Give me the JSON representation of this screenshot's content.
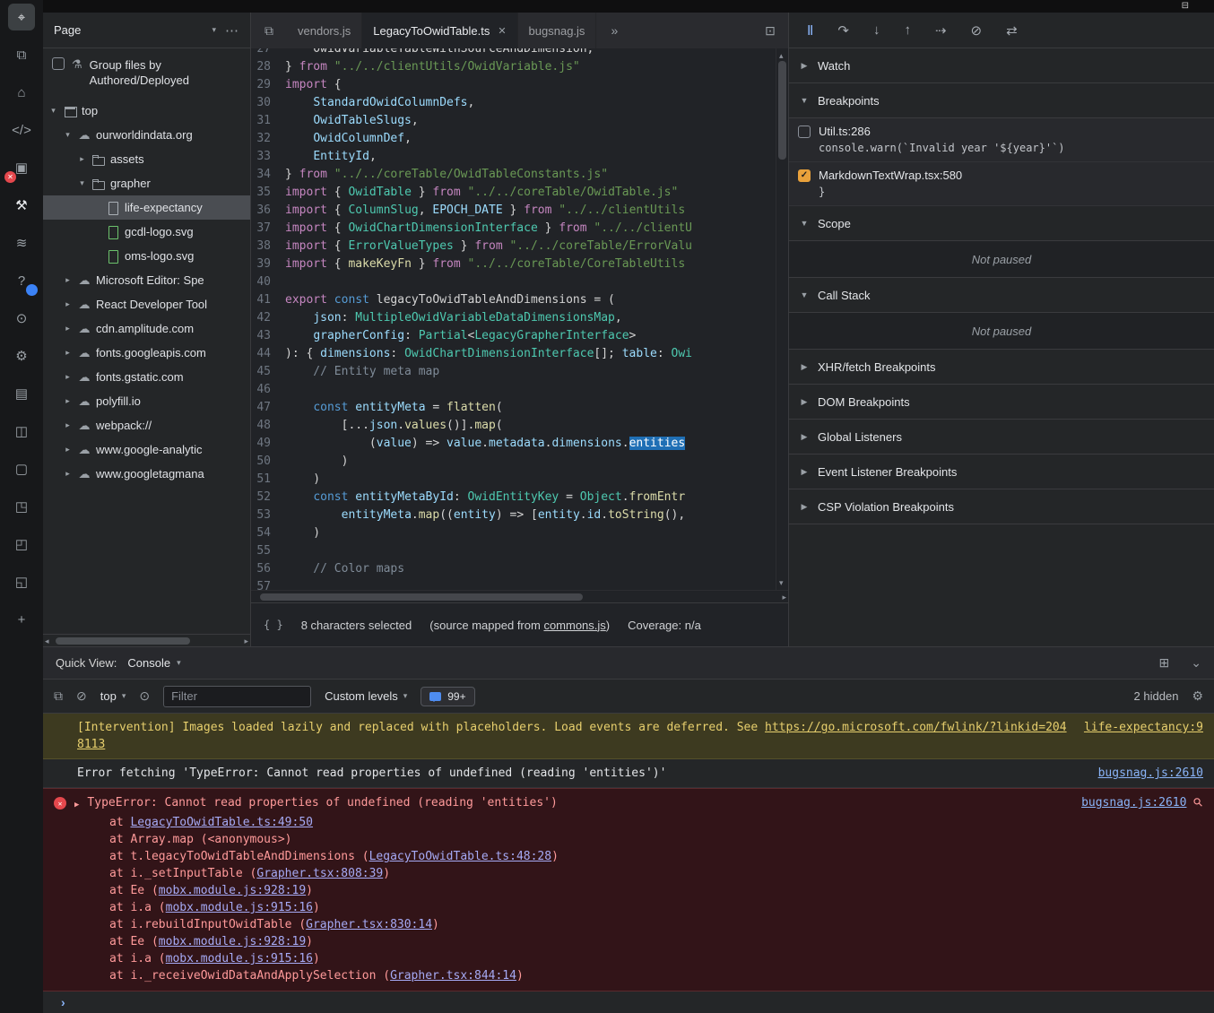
{
  "colors": {
    "breakpoint_checked": "#e9a13b",
    "warning_text": "#e7cf6d",
    "error_text": "#ff9a9a",
    "link_blue": "#8ab4f8",
    "stack_link": "#a6aaf5",
    "selection_highlight": "#1f6fb5",
    "breakpoint_badge_red": "#e5484d",
    "badge_blue": "#3b82f6"
  },
  "titlebar": {
    "dock_icon_glyph": "⊟"
  },
  "activity_bar": {
    "icons": [
      {
        "name": "inspect-element",
        "glyph": "⌖",
        "active": true
      },
      {
        "name": "device-emulation",
        "glyph": "⧉"
      },
      {
        "name": "welcome-home",
        "glyph": "⌂"
      },
      {
        "name": "elements",
        "glyph": "</>"
      },
      {
        "name": "console-errors",
        "glyph": "▣",
        "badge": "red",
        "badge_glyph": "✕"
      },
      {
        "name": "debugger",
        "glyph": "⚒",
        "hl": true
      },
      {
        "name": "network",
        "glyph": "≋"
      },
      {
        "name": "issues-help",
        "glyph": "?",
        "badge": "blue",
        "badge_glyph": ""
      },
      {
        "name": "performance",
        "glyph": "⊙"
      },
      {
        "name": "settings-gear",
        "glyph": "⚙"
      },
      {
        "name": "layers",
        "glyph": "▤"
      },
      {
        "name": "application",
        "glyph": "◫"
      },
      {
        "name": "sources-box",
        "glyph": "▢"
      },
      {
        "name": "package",
        "glyph": "◳"
      },
      {
        "name": "extension-a",
        "glyph": "◰"
      },
      {
        "name": "extension-b",
        "glyph": "◱"
      },
      {
        "name": "more-tools-add",
        "glyph": "+"
      }
    ]
  },
  "navigator": {
    "header": {
      "dropdown_label": "Page",
      "more_glyph": "⋯",
      "chevron": "▾"
    },
    "group_toggle": {
      "label": "Group files by Authored/Deployed",
      "checked": false,
      "flask_glyph": "⚗"
    },
    "tree": [
      {
        "label": "top",
        "type": "frame",
        "depth": 0,
        "chevron": "expanded"
      },
      {
        "label": "ourworldindata.org",
        "type": "domain",
        "depth": 1,
        "chevron": "expanded"
      },
      {
        "label": "assets",
        "type": "folder",
        "depth": 2,
        "chevron": "collapsed"
      },
      {
        "label": "grapher",
        "type": "folder",
        "depth": 2,
        "chevron": "expanded"
      },
      {
        "label": "life-expectancy",
        "type": "file",
        "depth": 3,
        "selected": true
      },
      {
        "label": "gcdl-logo.svg",
        "type": "image-file",
        "depth": 3
      },
      {
        "label": "oms-logo.svg",
        "type": "image-file",
        "depth": 3
      },
      {
        "label": "Microsoft Editor: Spe",
        "type": "domain",
        "depth": 1,
        "chevron": "collapsed"
      },
      {
        "label": "React Developer Tool",
        "type": "domain",
        "depth": 1,
        "chevron": "collapsed"
      },
      {
        "label": "cdn.amplitude.com",
        "type": "domain",
        "depth": 1,
        "chevron": "collapsed"
      },
      {
        "label": "fonts.googleapis.com",
        "type": "domain",
        "depth": 1,
        "chevron": "collapsed"
      },
      {
        "label": "fonts.gstatic.com",
        "type": "domain",
        "depth": 1,
        "chevron": "collapsed"
      },
      {
        "label": "polyfill.io",
        "type": "domain",
        "depth": 1,
        "chevron": "collapsed"
      },
      {
        "label": "webpack://",
        "type": "domain",
        "depth": 1,
        "chevron": "collapsed"
      },
      {
        "label": "www.google-analytic",
        "type": "domain",
        "depth": 1,
        "chevron": "collapsed"
      },
      {
        "label": "www.googletagmana",
        "type": "domain",
        "depth": 1,
        "chevron": "collapsed"
      }
    ]
  },
  "editor": {
    "tabs": {
      "open_icon_glyph": "⧉",
      "overflow_glyph": "»",
      "panel_icon_glyph": "⊡",
      "close_glyph": "✕",
      "items": [
        {
          "label": "vendors.js",
          "active": false
        },
        {
          "label": "LegacyToOwidTable.ts",
          "active": true,
          "closable": true
        },
        {
          "label": "bugsnag.js",
          "active": false
        }
      ]
    },
    "lines": [
      {
        "num": 27,
        "tokens": [
          [
            "d",
            "    OwidVariableTableWithSourceAndDimension,"
          ]
        ]
      },
      {
        "num": 28,
        "tokens": [
          [
            "d",
            "} "
          ],
          [
            "k",
            "from"
          ],
          [
            "d",
            " "
          ],
          [
            "s",
            "\"../../clientUtils/OwidVariable.js\""
          ]
        ]
      },
      {
        "num": 29,
        "tokens": [
          [
            "k",
            "import"
          ],
          [
            "d",
            " {"
          ]
        ]
      },
      {
        "num": 30,
        "tokens": [
          [
            "d",
            "    "
          ],
          [
            "v",
            "StandardOwidColumnDefs"
          ],
          [
            "d",
            ","
          ]
        ]
      },
      {
        "num": 31,
        "tokens": [
          [
            "d",
            "    "
          ],
          [
            "v",
            "OwidTableSlugs"
          ],
          [
            "d",
            ","
          ]
        ]
      },
      {
        "num": 32,
        "tokens": [
          [
            "d",
            "    "
          ],
          [
            "v",
            "OwidColumnDef"
          ],
          [
            "d",
            ","
          ]
        ]
      },
      {
        "num": 33,
        "tokens": [
          [
            "d",
            "    "
          ],
          [
            "v",
            "EntityId"
          ],
          [
            "d",
            ","
          ]
        ]
      },
      {
        "num": 34,
        "tokens": [
          [
            "d",
            "} "
          ],
          [
            "k",
            "from"
          ],
          [
            "d",
            " "
          ],
          [
            "s",
            "\"../../coreTable/OwidTableConstants.js\""
          ]
        ]
      },
      {
        "num": 35,
        "tokens": [
          [
            "k",
            "import"
          ],
          [
            "d",
            " { "
          ],
          [
            "t",
            "OwidTable"
          ],
          [
            "d",
            " } "
          ],
          [
            "k",
            "from"
          ],
          [
            "d",
            " "
          ],
          [
            "s",
            "\"../../coreTable/OwidTable.js\""
          ]
        ]
      },
      {
        "num": 36,
        "tokens": [
          [
            "k",
            "import"
          ],
          [
            "d",
            " { "
          ],
          [
            "t",
            "ColumnSlug"
          ],
          [
            "d",
            ", "
          ],
          [
            "v",
            "EPOCH_DATE"
          ],
          [
            "d",
            " } "
          ],
          [
            "k",
            "from"
          ],
          [
            "d",
            " "
          ],
          [
            "s",
            "\"../../clientUtils"
          ]
        ]
      },
      {
        "num": 37,
        "tokens": [
          [
            "k",
            "import"
          ],
          [
            "d",
            " { "
          ],
          [
            "t",
            "OwidChartDimensionInterface"
          ],
          [
            "d",
            " } "
          ],
          [
            "k",
            "from"
          ],
          [
            "d",
            " "
          ],
          [
            "s",
            "\"../../clientU"
          ]
        ]
      },
      {
        "num": 38,
        "tokens": [
          [
            "k",
            "import"
          ],
          [
            "d",
            " { "
          ],
          [
            "t",
            "ErrorValueTypes"
          ],
          [
            "d",
            " } "
          ],
          [
            "k",
            "from"
          ],
          [
            "d",
            " "
          ],
          [
            "s",
            "\"../../coreTable/ErrorValu"
          ]
        ]
      },
      {
        "num": 39,
        "tokens": [
          [
            "k",
            "import"
          ],
          [
            "d",
            " { "
          ],
          [
            "f",
            "makeKeyFn"
          ],
          [
            "d",
            " } "
          ],
          [
            "k",
            "from"
          ],
          [
            "d",
            " "
          ],
          [
            "s",
            "\"../../coreTable/CoreTableUtils"
          ]
        ]
      },
      {
        "num": 40,
        "tokens": []
      },
      {
        "num": 41,
        "tokens": [
          [
            "k",
            "export"
          ],
          [
            "d",
            " "
          ],
          [
            "kb",
            "const"
          ],
          [
            "d",
            " legacyToOwidTableAndDimensions = ("
          ]
        ]
      },
      {
        "num": 42,
        "tokens": [
          [
            "d",
            "    "
          ],
          [
            "v",
            "json"
          ],
          [
            "d",
            ": "
          ],
          [
            "t",
            "MultipleOwidVariableDataDimensionsMap"
          ],
          [
            "d",
            ","
          ]
        ]
      },
      {
        "num": 43,
        "tokens": [
          [
            "d",
            "    "
          ],
          [
            "v",
            "grapherConfig"
          ],
          [
            "d",
            ": "
          ],
          [
            "t",
            "Partial"
          ],
          [
            "d",
            "<"
          ],
          [
            "t",
            "LegacyGrapherInterface"
          ],
          [
            "d",
            ">"
          ]
        ]
      },
      {
        "num": 44,
        "tokens": [
          [
            "d",
            "): { "
          ],
          [
            "v",
            "dimensions"
          ],
          [
            "d",
            ": "
          ],
          [
            "t",
            "OwidChartDimensionInterface"
          ],
          [
            "d",
            "[]; "
          ],
          [
            "v",
            "table"
          ],
          [
            "d",
            ": "
          ],
          [
            "t",
            "Owi"
          ]
        ]
      },
      {
        "num": 45,
        "tokens": [
          [
            "c",
            "    // Entity meta map"
          ]
        ]
      },
      {
        "num": 46,
        "tokens": []
      },
      {
        "num": 47,
        "tokens": [
          [
            "d",
            "    "
          ],
          [
            "kb",
            "const"
          ],
          [
            "d",
            " "
          ],
          [
            "v",
            "entityMeta"
          ],
          [
            "d",
            " = "
          ],
          [
            "f",
            "flatten"
          ],
          [
            "d",
            "("
          ]
        ]
      },
      {
        "num": 48,
        "tokens": [
          [
            "d",
            "        [..."
          ],
          [
            "v",
            "json"
          ],
          [
            "d",
            "."
          ],
          [
            "f",
            "values"
          ],
          [
            "d",
            "()]."
          ],
          [
            "f",
            "map"
          ],
          [
            "d",
            "("
          ]
        ]
      },
      {
        "num": 49,
        "tokens": [
          [
            "d",
            "            ("
          ],
          [
            "v",
            "value"
          ],
          [
            "d",
            ") => "
          ],
          [
            "v",
            "value"
          ],
          [
            "d",
            "."
          ],
          [
            "v",
            "metadata"
          ],
          [
            "d",
            "."
          ],
          [
            "v",
            "dimensions"
          ],
          [
            "d",
            "."
          ],
          [
            "sel",
            "entities"
          ]
        ]
      },
      {
        "num": 50,
        "tokens": [
          [
            "d",
            "        )"
          ]
        ]
      },
      {
        "num": 51,
        "tokens": [
          [
            "d",
            "    )"
          ]
        ]
      },
      {
        "num": 52,
        "tokens": [
          [
            "d",
            "    "
          ],
          [
            "kb",
            "const"
          ],
          [
            "d",
            " "
          ],
          [
            "v",
            "entityMetaById"
          ],
          [
            "d",
            ": "
          ],
          [
            "t",
            "OwidEntityKey"
          ],
          [
            "d",
            " = "
          ],
          [
            "t",
            "Object"
          ],
          [
            "d",
            "."
          ],
          [
            "f",
            "fromEntr"
          ]
        ]
      },
      {
        "num": 53,
        "tokens": [
          [
            "d",
            "        "
          ],
          [
            "v",
            "entityMeta"
          ],
          [
            "d",
            "."
          ],
          [
            "f",
            "map"
          ],
          [
            "d",
            "(("
          ],
          [
            "v",
            "entity"
          ],
          [
            "d",
            ") => ["
          ],
          [
            "v",
            "entity"
          ],
          [
            "d",
            "."
          ],
          [
            "v",
            "id"
          ],
          [
            "d",
            "."
          ],
          [
            "f",
            "toString"
          ],
          [
            "d",
            "(),"
          ]
        ]
      },
      {
        "num": 54,
        "tokens": [
          [
            "d",
            "    )"
          ]
        ]
      },
      {
        "num": 55,
        "tokens": []
      },
      {
        "num": 56,
        "tokens": [
          [
            "c",
            "    // Color maps"
          ]
        ]
      },
      {
        "num": 57,
        "tokens": []
      }
    ],
    "status": {
      "brace_glyph": "{ }",
      "selection": "8 characters selected",
      "mapped_prefix": "(source mapped from ",
      "mapped_link": "commons.js",
      "mapped_suffix": ")",
      "coverage": "Coverage: n/a"
    }
  },
  "debug_sidebar": {
    "toolbar": [
      {
        "name": "pause",
        "glyph": "Ⅱ",
        "accent": true
      },
      {
        "name": "step-over",
        "glyph": "↷"
      },
      {
        "name": "step-into",
        "glyph": "↓"
      },
      {
        "name": "step-out",
        "glyph": "↑"
      },
      {
        "name": "step",
        "glyph": "⇢"
      },
      {
        "name": "deactivate-breakpoints",
        "glyph": "⊘"
      },
      {
        "name": "pause-on-exceptions",
        "glyph": "⇄"
      }
    ],
    "sections": [
      {
        "label": "Watch",
        "collapsed": true
      },
      {
        "label": "Breakpoints",
        "collapsed": false,
        "kind": "breakpoints"
      },
      {
        "label": "Scope",
        "collapsed": false,
        "kind": "message",
        "message": "Not paused"
      },
      {
        "label": "Call Stack",
        "collapsed": false,
        "kind": "message",
        "message": "Not paused"
      },
      {
        "label": "XHR/fetch Breakpoints",
        "collapsed": true
      },
      {
        "label": "DOM Breakpoints",
        "collapsed": true
      },
      {
        "label": "Global Listeners",
        "collapsed": true
      },
      {
        "label": "Event Listener Breakpoints",
        "collapsed": true
      },
      {
        "label": "CSP Violation Breakpoints",
        "collapsed": true
      }
    ],
    "breakpoints": [
      {
        "checked": false,
        "title": "Util.ts:286",
        "code": "console.warn(`Invalid year '${year}'`)"
      },
      {
        "checked": true,
        "title": "MarkdownTextWrap.tsx:580",
        "code": "}"
      }
    ]
  },
  "quick_view": {
    "label": "Quick View:",
    "dropdown": "Console",
    "chevron": "▾",
    "dock_glyph": "⊞",
    "collapse_glyph": "⌄"
  },
  "console_panel": {
    "toolbar": {
      "sidebar_icon": "⧉",
      "clear_icon": "⊘",
      "context": "top",
      "eye_icon": "⊙",
      "filter_placeholder": "Filter",
      "levels_label": "Custom levels",
      "badge_count": "99+",
      "hidden_label": "2 hidden",
      "settings_icon": "⚙",
      "chevron": "▾"
    },
    "messages": {
      "warning": {
        "text": "[Intervention] Images loaded lazily and replaced with placeholders. Load events are deferred. See ",
        "link": "https://go.microsoft.com/fwlink/?linkid=2048113",
        "source": "life-expectancy:9"
      },
      "log": {
        "text": "Error fetching 'TypeError: Cannot read properties of undefined (reading 'entities')'",
        "source": "bugsnag.js:2610"
      },
      "error": {
        "title": "TypeError: Cannot read properties of undefined (reading 'entities')",
        "source": "bugsnag.js:2610",
        "stack": [
          {
            "pre": "at ",
            "link": "LegacyToOwidTable.ts:49:50",
            "post": ""
          },
          {
            "pre": "at Array.map (<anonymous>)"
          },
          {
            "pre": "at t.legacyToOwidTableAndDimensions (",
            "link": "LegacyToOwidTable.ts:48:28",
            "post": ")"
          },
          {
            "pre": "at i._setInputTable (",
            "link": "Grapher.tsx:808:39",
            "post": ")"
          },
          {
            "pre": "at Ee (",
            "link": "mobx.module.js:928:19",
            "post": ")"
          },
          {
            "pre": "at i.a (",
            "link": "mobx.module.js:915:16",
            "post": ")"
          },
          {
            "pre": "at i.rebuildInputOwidTable (",
            "link": "Grapher.tsx:830:14",
            "post": ")"
          },
          {
            "pre": "at Ee (",
            "link": "mobx.module.js:928:19",
            "post": ")"
          },
          {
            "pre": "at i.a (",
            "link": "mobx.module.js:915:16",
            "post": ")"
          },
          {
            "pre": "at i._receiveOwidDataAndApplySelection (",
            "link": "Grapher.tsx:844:14",
            "post": ")"
          }
        ]
      }
    },
    "prompt_glyph": "›"
  }
}
